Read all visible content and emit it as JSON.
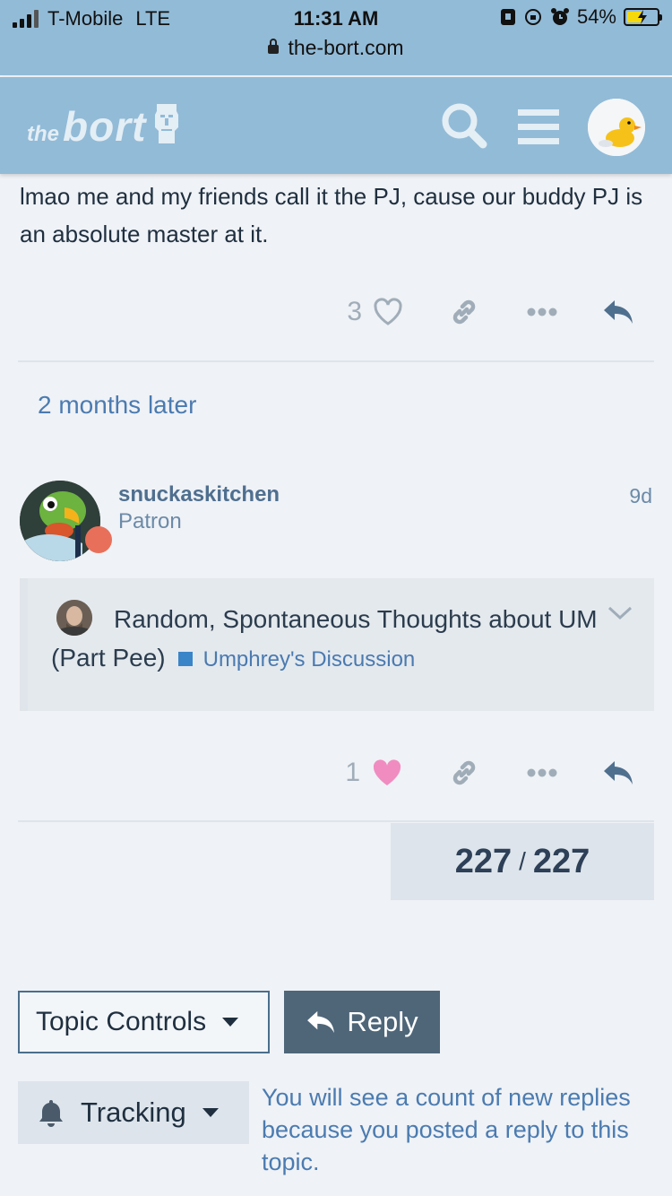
{
  "status_bar": {
    "carrier": "T-Mobile",
    "network": "LTE",
    "time": "11:31 AM",
    "battery": "54%",
    "battery_level": 0.54,
    "url": "the-bort.com"
  },
  "header": {
    "logo_the": "the",
    "logo_bort": "bort",
    "search_icon": "search-icon",
    "menu_icon": "hamburger-menu-icon",
    "avatar_icon": "rubber-duck-avatar"
  },
  "post_prev": {
    "text": "lmao me and my friends call it the PJ, cause our buddy PJ is an absolute master at it.",
    "like_count": "3"
  },
  "time_gap": "2 months later",
  "post": {
    "username": "snuckaskitchen",
    "user_title": "Patron",
    "date": "9d",
    "quote": {
      "title": "Random, Spontaneous Thoughts about UM (Part Pee)",
      "category": "Umphrey's Discussion",
      "category_color": "#3a85c8"
    },
    "like_count": "1",
    "liked_color": "#f08cc0"
  },
  "progress": {
    "current": "227",
    "separator": "/",
    "total": "227"
  },
  "footer": {
    "topic_controls_label": "Topic Controls",
    "reply_label": "Reply",
    "tracking_label": "Tracking",
    "tracking_desc": "You will see a count of new replies because you posted a reply to this topic."
  }
}
